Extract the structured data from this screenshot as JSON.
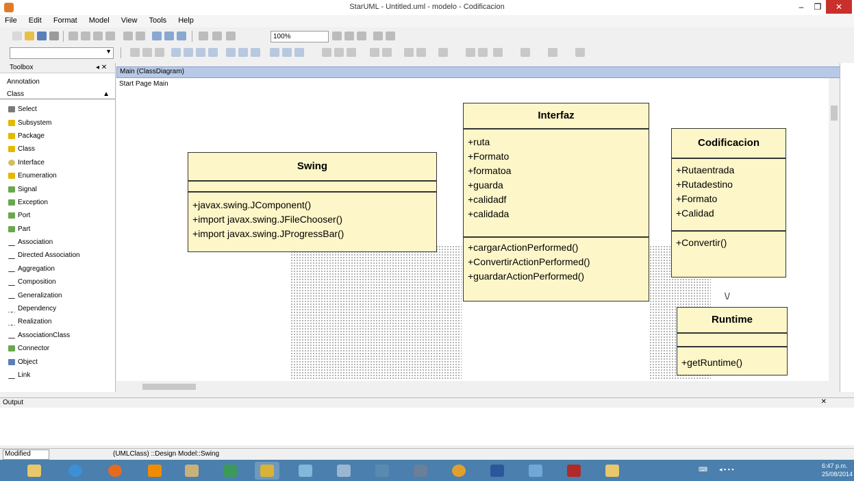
{
  "window": {
    "title": "StarUML - Untitled.uml - modelo - Codificacion"
  },
  "menu": [
    "File",
    "Edit",
    "Format",
    "Model",
    "View",
    "Tools",
    "Help"
  ],
  "toolbar": {
    "zoom": "100%"
  },
  "palette": {
    "title": "Toolbox",
    "section": "Annotation",
    "group": "Class",
    "items": [
      "Select",
      "Subsystem",
      "Package",
      "Class",
      "Interface",
      "Enumeration",
      "Signal",
      "Exception",
      "Port",
      "Part",
      "Association",
      "Directed Association",
      "Aggregation",
      "Composition",
      "Generalization",
      "Dependency",
      "Realization",
      "AssociationClass",
      "Connector",
      "Object",
      "Link"
    ]
  },
  "diagram": {
    "tab": "Main (ClassDiagram)",
    "subtabs": "Start Page  Main",
    "classes": [
      {
        "name": "Interfaz",
        "attributes": [
          "+ruta",
          "+Formato",
          "+formatoa",
          "+guarda",
          "+calidadf",
          "+calidada"
        ],
        "operations": [
          "+cargarActionPerformed()",
          "+ConvertirActionPerformed()",
          "+guardarActionPerformed()"
        ]
      },
      {
        "name": "Swing",
        "attributes": [],
        "operations": [
          "+javax.swing.JComponent()",
          "+import javax.swing.JFileChooser()",
          "+import javax.swing.JProgressBar()"
        ]
      },
      {
        "name": "Codificacion",
        "attributes": [
          "+Rutaentrada",
          "+Rutadestino",
          "+Formato",
          "+Calidad"
        ],
        "operations": [
          "+Convertir()"
        ]
      },
      {
        "name": "Runtime",
        "attributes": [],
        "operations": [
          "+getRuntime()"
        ]
      }
    ]
  },
  "lower": {
    "title": "Output"
  },
  "status": {
    "left": "Modified",
    "path": "(UMLClass) ::Design Model::Swing"
  },
  "tray": {
    "time": "6:47 p.m.",
    "date": "25/08/2014"
  },
  "colors": {
    "class_fill": "#fdf6c8",
    "tab_header": "#b7c9e6",
    "taskbar": "#4a7fae"
  }
}
